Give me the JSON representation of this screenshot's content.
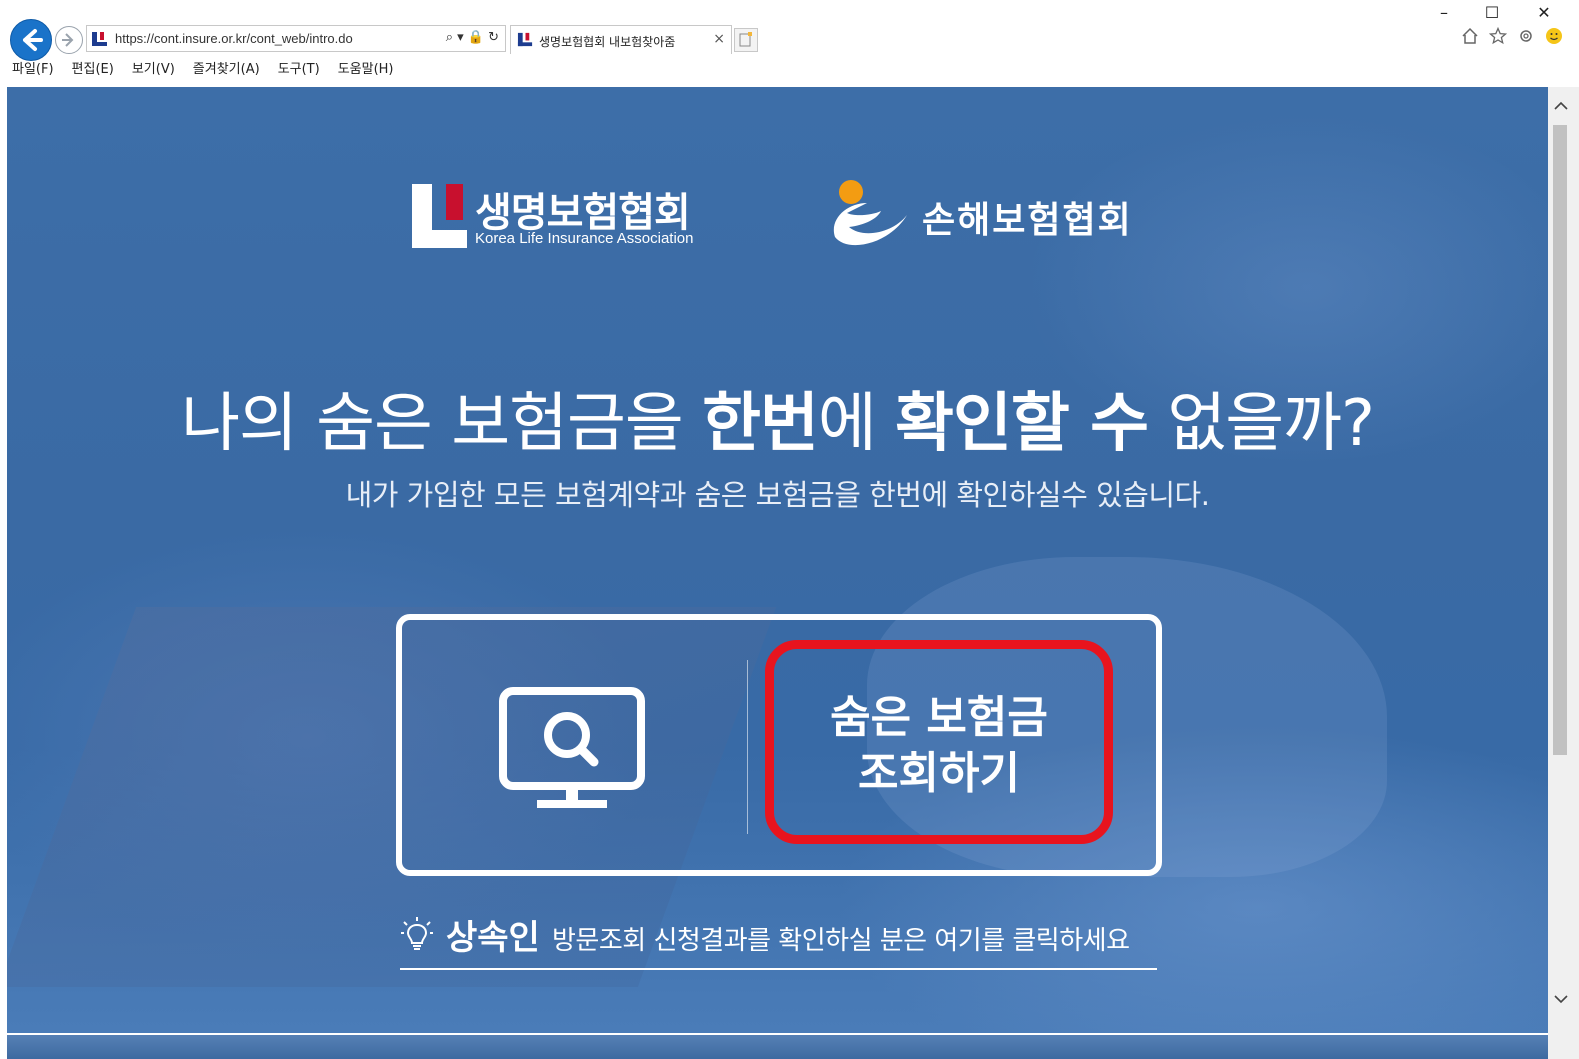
{
  "window": {
    "minimize": "–",
    "maximize": "☐",
    "close": "✕"
  },
  "browser": {
    "url": "https://cont.insure.or.kr/cont_web/intro.do",
    "address_tools": "⌕ ▾ 🔒 ↻",
    "tab_title": "생명보험협회 내보험찾아줌",
    "tab_close": "×",
    "menu": [
      "파일(F)",
      "편집(E)",
      "보기(V)",
      "즐겨찾기(A)",
      "도구(T)",
      "도움말(H)"
    ],
    "icons": [
      "home-icon",
      "favorites-star-icon",
      "settings-gear-icon",
      "feedback-smiley-icon"
    ]
  },
  "page": {
    "logos": {
      "life_ko": "생명보험협회",
      "life_en": "Korea Life Insurance Association",
      "nonlife_ko": "손해보험협회"
    },
    "headline": {
      "part1": "나의 숨은 보험금을 ",
      "bold1": "한번",
      "part2": "에 ",
      "bold2": "확인할 수",
      "part3": " 없을까?"
    },
    "subline": "내가 가입한 모든 보험계약과 숨은 보험금을 한번에 확인하실수 있습니다.",
    "cta": {
      "line1": "숨은 보험금",
      "line2": "조회하기"
    },
    "heir": {
      "strong": "상속인",
      "rest": "방문조회 신청결과를 확인하실 분은 여기를 클릭하세요"
    }
  },
  "colors": {
    "page_bg": "#3a6aa4",
    "highlight_red": "#e8141e",
    "ie_blue": "#1a73c9",
    "logo_red": "#c8102e",
    "nonlife_orange": "#f39c12"
  }
}
